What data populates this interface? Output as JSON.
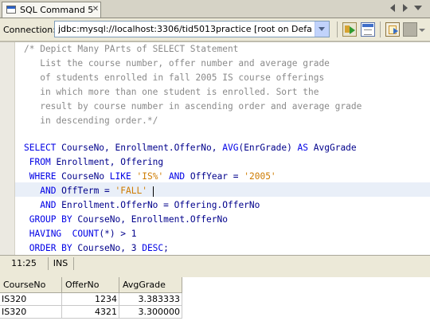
{
  "tab": {
    "title": "SQL Command 5",
    "close_glyph": "✕"
  },
  "toolbar": {
    "connection_label": "Connection:",
    "connection_value": "jdbc:mysql://localhost:3306/tid5013practice [root on Default sc..."
  },
  "editor": {
    "comment_lines": [
      "/* Depict Many PArts of SELECT Statement",
      "   List the course number, offer number and average grade",
      "   of students enrolled in fall 2005 IS course offerings",
      "   in which more than one student is enrolled. Sort the",
      "   result by course number in ascending order and average grade",
      "   in descending order.*/"
    ],
    "sql": {
      "l1": {
        "kw1": "SELECT",
        "rest1": " CourseNo, Enrollment.OfferNo, ",
        "fn": "AVG",
        "rest2": "(EnrGrade) ",
        "kw2": "AS",
        "rest3": " AvgGrade"
      },
      "l2": {
        "indent": " ",
        "kw": "FROM",
        "rest": " Enrollment, Offering"
      },
      "l3": {
        "indent": " ",
        "kw1": "WHERE",
        "rest1": " CourseNo ",
        "kw2": "LIKE",
        "sp": " ",
        "str1": "'IS%'",
        "sp2": " ",
        "kw3": "AND",
        "rest2": " OffYear = ",
        "str2": "'2005'"
      },
      "l4": {
        "indent": "   ",
        "kw": "AND",
        "rest": " OffTerm = ",
        "str": "'FALL'",
        "tail": " "
      },
      "l5": {
        "indent": "   ",
        "kw": "AND",
        "rest": " Enrollment.OfferNo = Offering.OfferNo"
      },
      "l6": {
        "indent": " ",
        "kw": "GROUP BY",
        "rest": " CourseNo, Enrollment.OfferNo"
      },
      "l7": {
        "indent": " ",
        "kw": "HAVING",
        "sp": "  ",
        "fn": "COUNT",
        "rest": "(*) > 1"
      },
      "l8": {
        "indent": " ",
        "kw": "ORDER BY",
        "rest1": " CourseNo, 3 ",
        "kw2": "DESC",
        "rest2": ";"
      }
    }
  },
  "statusbar": {
    "position": "11:25",
    "mode": "INS"
  },
  "results": {
    "columns": [
      "CourseNo",
      "OfferNo",
      "AvgGrade"
    ],
    "rows": [
      [
        "IS320",
        "1234",
        "3.383333"
      ],
      [
        "IS320",
        "4321",
        "3.300000"
      ]
    ]
  }
}
